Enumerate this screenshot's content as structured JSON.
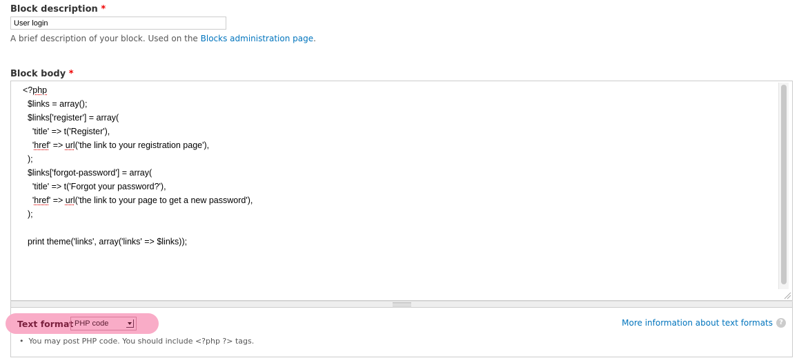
{
  "description_field": {
    "label": "Block description",
    "required_marker": "*",
    "value": "User login",
    "help_prefix": "A brief description of your block. Used on the ",
    "help_link": "Blocks administration page",
    "help_suffix": "."
  },
  "body_field": {
    "label": "Block body",
    "required_marker": "*",
    "code_lines": [
      "<?php",
      "  $links = array();",
      "  $links['register'] = array(",
      "    'title' => t('Register'),",
      "    'href' => url('the link to your registration page'),",
      "  );",
      "  $links['forgot-password'] = array(",
      "    'title' => t('Forgot your password?'),",
      "    'href' => url('the link to your page to get a new password'),",
      "  );",
      "",
      "  print theme('links', array('links' => $links));"
    ]
  },
  "text_format": {
    "label": "Text format",
    "selected": "PHP code",
    "tip": "You may post PHP code. You should include <?php ?> tags.",
    "more_info_link": "More information about text formats",
    "help_icon": "?"
  },
  "colors": {
    "link": "#0074bd",
    "required": "#ee0000",
    "highlight": "#f9a8c4"
  }
}
